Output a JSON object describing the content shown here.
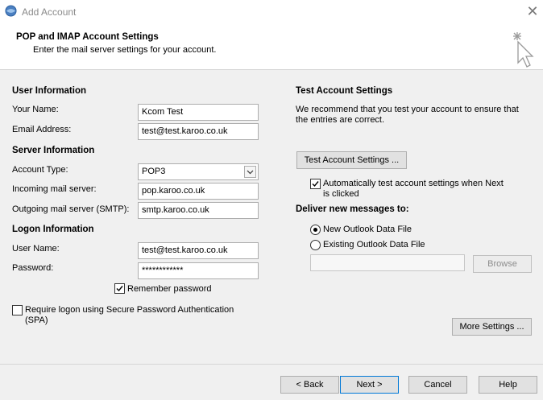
{
  "window": {
    "title": "Add Account",
    "close_glyph": "✕"
  },
  "header": {
    "title": "POP and IMAP Account Settings",
    "subtitle": "Enter the mail server settings for your account."
  },
  "user_info": {
    "section": "User Information",
    "name_label": "Your Name:",
    "name_value": "Kcom Test",
    "email_label": "Email Address:",
    "email_value": "test@test.karoo.co.uk"
  },
  "server_info": {
    "section": "Server Information",
    "type_label": "Account Type:",
    "type_value": "POP3",
    "incoming_label": "Incoming mail server:",
    "incoming_value": "pop.karoo.co.uk",
    "outgoing_label": "Outgoing mail server (SMTP):",
    "outgoing_value": "smtp.karoo.co.uk"
  },
  "logon_info": {
    "section": "Logon Information",
    "user_label": "User Name:",
    "user_value": "test@test.karoo.co.uk",
    "password_label": "Password:",
    "password_value": "************",
    "remember_label": "Remember password",
    "spa_label_line1": "Require logon using Secure Password Authentication",
    "spa_label_line2": "(SPA)"
  },
  "test_settings": {
    "section": "Test Account Settings",
    "desc_line1": "We recommend that you test your account to ensure that",
    "desc_line2": "the entries are correct.",
    "test_button": "Test Account Settings ...",
    "auto_test_line1": "Automatically test account settings when Next",
    "auto_test_line2": "is clicked"
  },
  "deliver": {
    "section": "Deliver new messages to:",
    "new_file": "New Outlook Data File",
    "existing_file": "Existing Outlook Data File",
    "existing_path": "",
    "browse": "Browse"
  },
  "buttons": {
    "more_settings": "More Settings ...",
    "back": "< Back",
    "next": "Next >",
    "cancel": "Cancel",
    "help": "Help"
  },
  "icons": {
    "app": "outlook-globe-icon",
    "wizard": "sparkle-cursor-icon"
  }
}
